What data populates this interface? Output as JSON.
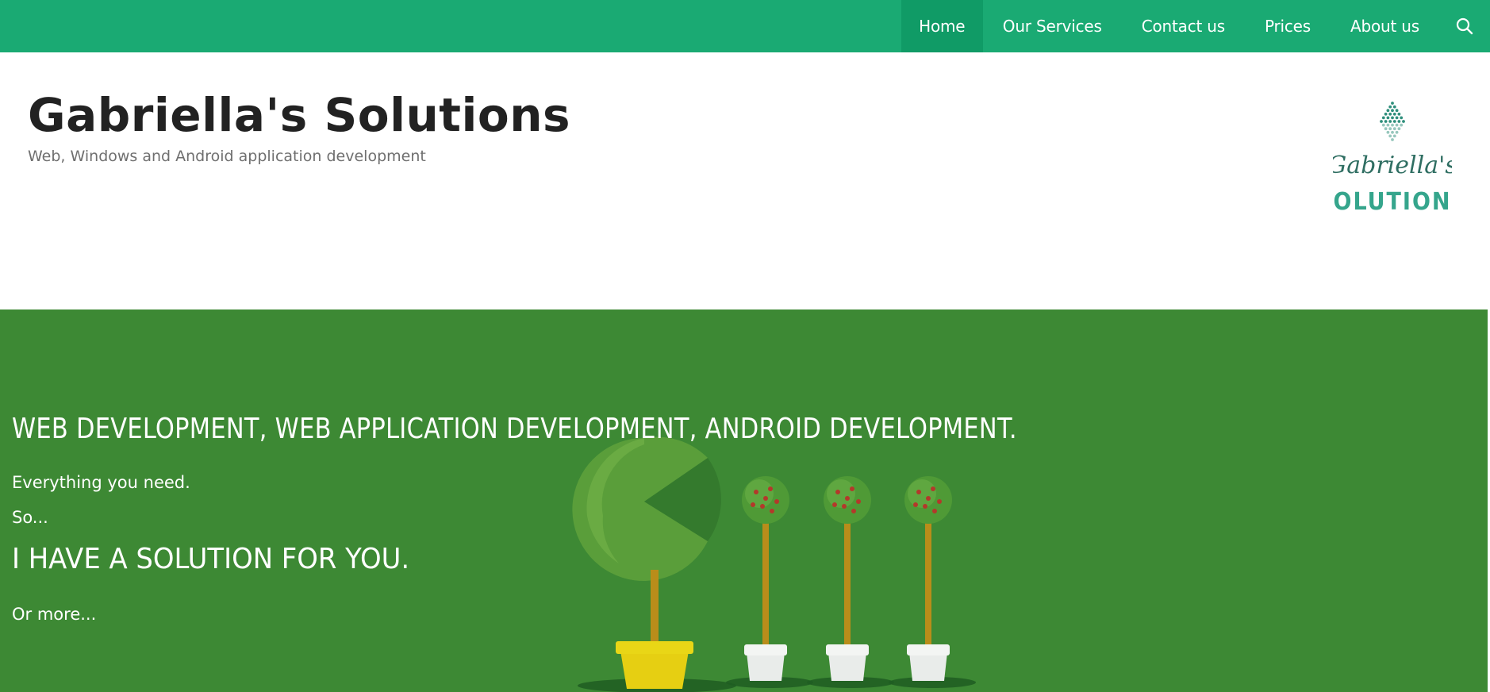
{
  "nav": {
    "items": [
      {
        "label": "Home",
        "active": true
      },
      {
        "label": "Our Services"
      },
      {
        "label": "Contact us"
      },
      {
        "label": "Prices"
      },
      {
        "label": "About us"
      }
    ],
    "search_icon": "search-icon"
  },
  "header": {
    "title": "Gabriella's Solutions",
    "tagline": "Web, Windows and Android application development",
    "logo": {
      "script_text": "Gabriella's",
      "block_text": "SOLUTIONS"
    }
  },
  "hero": {
    "heading": "WEB DEVELOPMENT, WEB APPLICATION DEVELOPMENT, ANDROID DEVELOPMENT.",
    "line1": "Everything you need.",
    "line2": "So...",
    "subheading": "I HAVE A SOLUTION FOR YOU.",
    "line3": "Or more..."
  },
  "colors": {
    "nav_bg": "#1aaa73",
    "nav_active_bg": "#109b66",
    "hero_bg": "#3d8934",
    "logo_teal": "#2f8f7c"
  }
}
